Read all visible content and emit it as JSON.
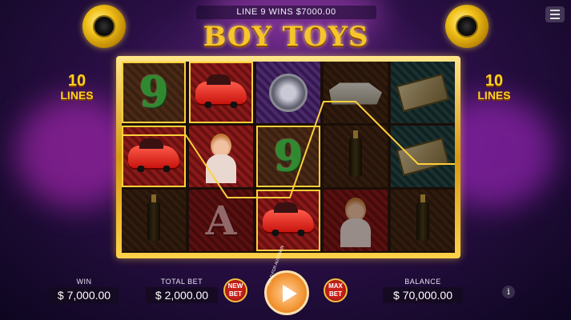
{
  "header": {
    "win_line_text": "LINE 9 WINS $7000.00",
    "logo_text": "BOY TOYS",
    "menu_icon": "menu-icon"
  },
  "lines_badge": {
    "number": "10",
    "label": "LINES"
  },
  "reels": [
    [
      "nine",
      "car",
      "watch",
      "yacht",
      "money"
    ],
    [
      "car",
      "woman",
      "nine",
      "bottle",
      "money"
    ],
    [
      "bottle",
      "A",
      "car",
      "woman",
      "bottle"
    ]
  ],
  "symbol_text": {
    "nine": "9",
    "A": "A"
  },
  "win": {
    "label": "WIN",
    "value": "$ 7,000.00"
  },
  "total_bet": {
    "label": "TOTAL BET",
    "value": "$ 2,000.00"
  },
  "balance": {
    "label": "BALANCE",
    "value": "$ 70,000.00"
  },
  "buttons": {
    "new_bet": "NEW BET",
    "max_bet": "MAX BET",
    "spin_hold_text": "HOLD FOR AUTOSPIN",
    "info": "i"
  },
  "colors": {
    "gold": "#ffd21a",
    "payline": "#ffcf3a",
    "spin": "#f59a3a"
  }
}
